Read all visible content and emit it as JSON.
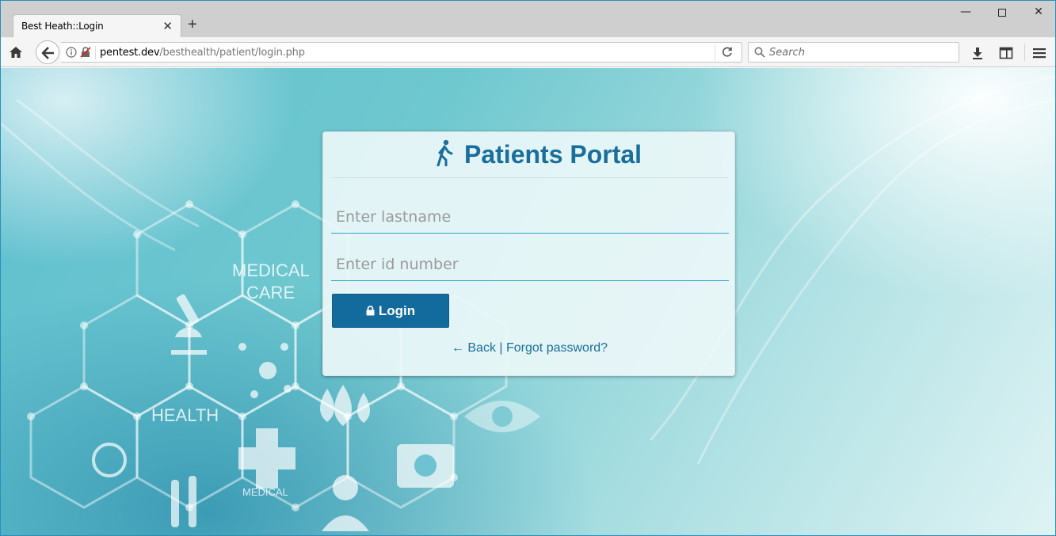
{
  "browser": {
    "tab_title": "Best Heath::Login",
    "url_domain": "pentest.dev",
    "url_path": "/besthealth/patient/login.php",
    "search_placeholder": "Search"
  },
  "background": {
    "labels": [
      "MEDICAL",
      "CARE",
      "HEALTH",
      "MEDICAL"
    ]
  },
  "login": {
    "title": "Patients Portal",
    "lastname_placeholder": "Enter lastname",
    "id_placeholder": "Enter id number",
    "button_label": "Login",
    "back_label": "← Back",
    "separator": "|",
    "forgot_label": "Forgot password?"
  },
  "colors": {
    "accent": "#1a6e9b",
    "button": "#136a9d",
    "input_underline": "#31a6cc"
  }
}
